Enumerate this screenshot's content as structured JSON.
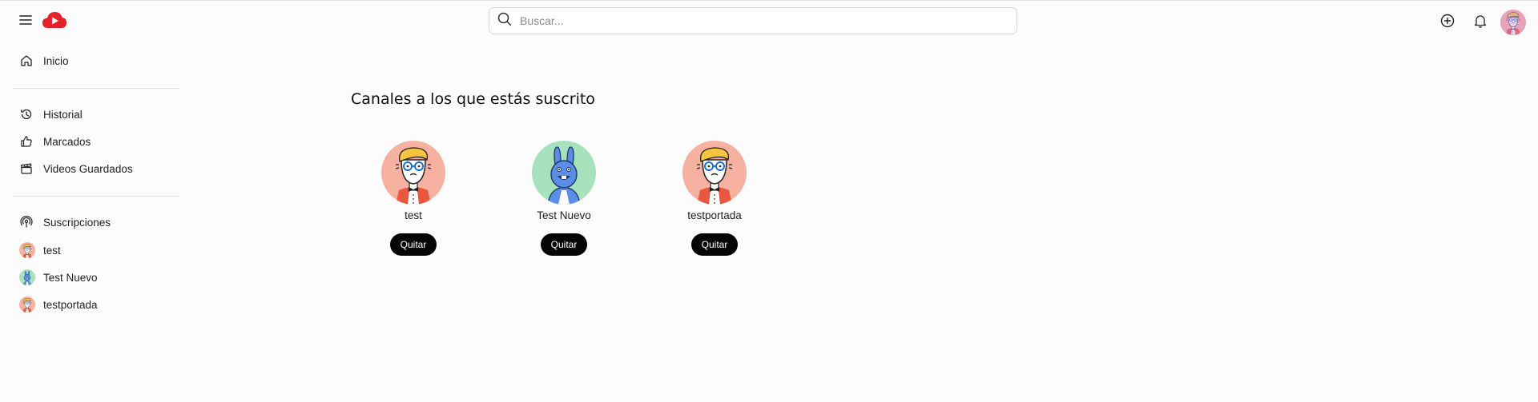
{
  "header": {
    "search_placeholder": "Buscar..."
  },
  "sidebar": {
    "main": [
      {
        "label": "Inicio",
        "icon": "home-icon"
      }
    ],
    "library": [
      {
        "label": "Historial",
        "icon": "history-icon"
      },
      {
        "label": "Marcados",
        "icon": "thumbs-up-icon"
      },
      {
        "label": "Videos Guardados",
        "icon": "clapperboard-icon"
      }
    ],
    "subscriptions_label": "Suscripciones",
    "subscriptions": [
      {
        "label": "test",
        "avatar": "boy"
      },
      {
        "label": "Test Nuevo",
        "avatar": "bunny"
      },
      {
        "label": "testportada",
        "avatar": "boy"
      }
    ]
  },
  "main": {
    "title": "Canales a los que estás suscrito",
    "channels": [
      {
        "name": "test",
        "button": "Quitar",
        "avatar": "boy"
      },
      {
        "name": "Test Nuevo",
        "button": "Quitar",
        "avatar": "bunny"
      },
      {
        "name": "testportada",
        "button": "Quitar",
        "avatar": "boy"
      }
    ]
  },
  "colors": {
    "brand": "#e8202a",
    "button_bg": "#050505",
    "avatar_boy_bg": "#f7b1a1",
    "avatar_bunny_bg": "#a6e3bd"
  }
}
